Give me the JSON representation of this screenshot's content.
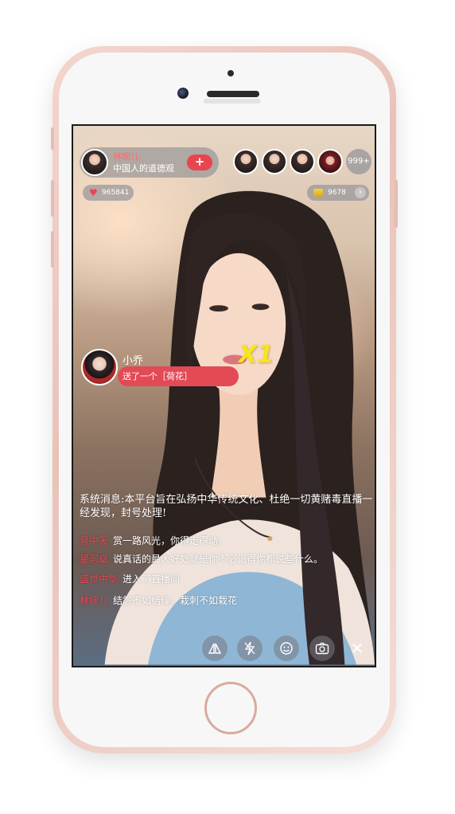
{
  "host": {
    "name": "林婉儿",
    "subtitle": "中国人的道德观",
    "follow_label": "+"
  },
  "viewers": {
    "count_label": "999+"
  },
  "stats": {
    "likes": "965841",
    "coins": "9678",
    "coins_arrow": "›"
  },
  "gift": {
    "user": "小乔",
    "message": "送了一个［荷花］",
    "count": "X1"
  },
  "chat": {
    "system_message": "系统消息:本平台旨在弘扬中华传统文化、杜绝一切黄赌毒直播一经发现，封号处理!",
    "messages": [
      {
        "nick": "易中天",
        "text": "赏一路风光，你得走得动;"
      },
      {
        "nick": "星河燊",
        "text": "说真话的最大好处就是你不必记得你都说些什么。"
      },
      {
        "nick": "盛世中华",
        "text": "进入了直播间"
      },
      {
        "nick": "林婉儿",
        "text": "结怨不如结缘，栽刺不如栽花"
      }
    ]
  },
  "toolbar": {
    "close_label": "✕"
  },
  "colors": {
    "accent": "#e8454f",
    "gift_count": "#f7e51a"
  }
}
